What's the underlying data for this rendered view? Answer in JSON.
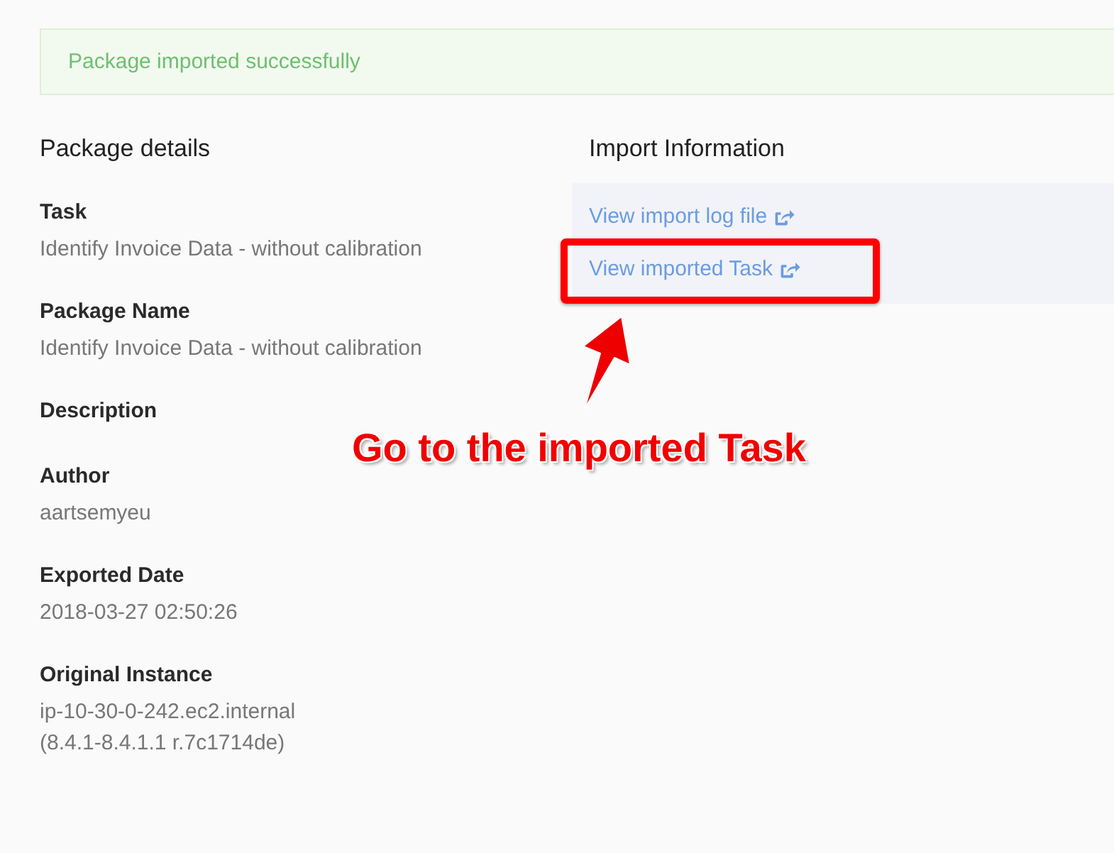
{
  "alert": {
    "message": "Package imported successfully"
  },
  "package_details": {
    "title": "Package details",
    "fields": [
      {
        "label": "Task",
        "value": "Identify Invoice Data - without calibration"
      },
      {
        "label": "Package Name",
        "value": "Identify Invoice Data - without calibration"
      },
      {
        "label": "Description"
      },
      {
        "label": "Author",
        "value": "aartsemyeu"
      },
      {
        "label": "Exported Date",
        "value": "2018-03-27 02:50:26"
      },
      {
        "label": "Original Instance",
        "value": "ip-10-30-0-242.ec2.internal\n(8.4.1-8.4.1.1 r.7c1714de)"
      }
    ]
  },
  "import_information": {
    "title": "Import Information",
    "links": [
      {
        "label": "View import log file",
        "highlighted": false
      },
      {
        "label": "View imported Task",
        "highlighted": true
      }
    ]
  },
  "annotation": {
    "text": "Go to the imported Task"
  }
}
